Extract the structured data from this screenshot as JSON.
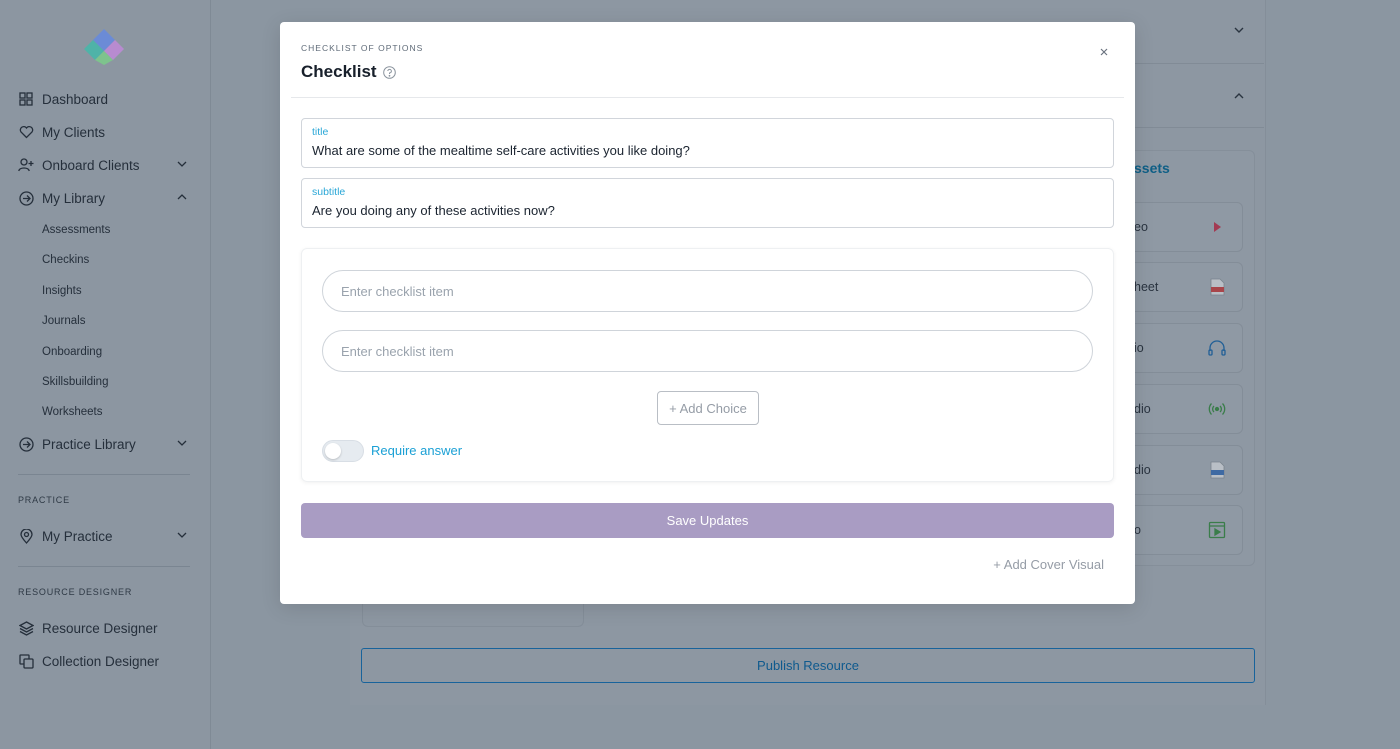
{
  "sidebar": {
    "nav": [
      {
        "label": "Dashboard",
        "icon": "grid-icon"
      },
      {
        "label": "My Clients",
        "icon": "heart-icon"
      },
      {
        "label": "Onboard Clients",
        "icon": "user-plus-icon"
      },
      {
        "label": "My Library",
        "icon": "arrow-circle-icon"
      }
    ],
    "library_items": [
      "Assessments",
      "Checkins",
      "Insights",
      "Journals",
      "Onboarding",
      "Skillsbuilding",
      "Worksheets"
    ],
    "practice_library": "Practice Library",
    "practice_section": "PRACTICE",
    "my_practice": "My Practice",
    "designer_section": "RESOURCE DESIGNER",
    "resource_designer": "Resource Designer",
    "collection_designer": "Collection Designer"
  },
  "background": {
    "assets_title": "ssets",
    "assets": [
      {
        "label": "eo",
        "icon": "play-icon"
      },
      {
        "label": "heet",
        "icon": "pdf-icon"
      },
      {
        "label": "io",
        "icon": "ai-audio-icon"
      },
      {
        "label": "dio",
        "icon": "broadcast-icon"
      },
      {
        "label": "dio",
        "icon": "audio-file-icon"
      },
      {
        "label": "o",
        "icon": "video-frame-icon"
      }
    ],
    "publish_label": "Publish Resource"
  },
  "modal": {
    "overline": "CHECKLIST OF OPTIONS",
    "title": "Checklist",
    "title_field": {
      "label": "title",
      "value": "What are some of the mealtime self-care activities you like doing?"
    },
    "subtitle_field": {
      "label": "subtitle",
      "value": "Are you doing any of these activities now?"
    },
    "choices": [
      {
        "placeholder": "Enter checklist item"
      },
      {
        "placeholder": "Enter checklist item"
      }
    ],
    "add_choice_label": "+ Add Choice",
    "require_label": "Require answer",
    "require_on": false,
    "save_label": "Save Updates",
    "cover_label": "+ Add Cover Visual"
  },
  "colors": {
    "accent": "#1ba0d5",
    "save_button": "#a99cc3",
    "publish_border": "#18639b"
  }
}
